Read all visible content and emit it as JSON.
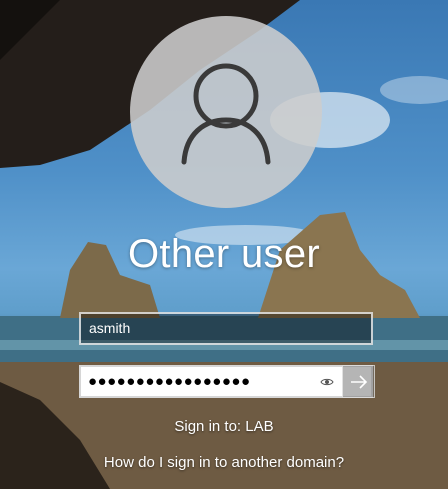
{
  "lock_screen": {
    "avatar_icon": "user-silhouette-icon",
    "title": "Other user",
    "username_value": "asmith",
    "password_masked": "●●●●●●●●●●●●●●●●●",
    "reveal_icon": "eye-icon",
    "submit_icon": "arrow-right-icon",
    "sign_in_to": "Sign in to: LAB",
    "other_domain_link": "How do I sign in to another domain?"
  }
}
